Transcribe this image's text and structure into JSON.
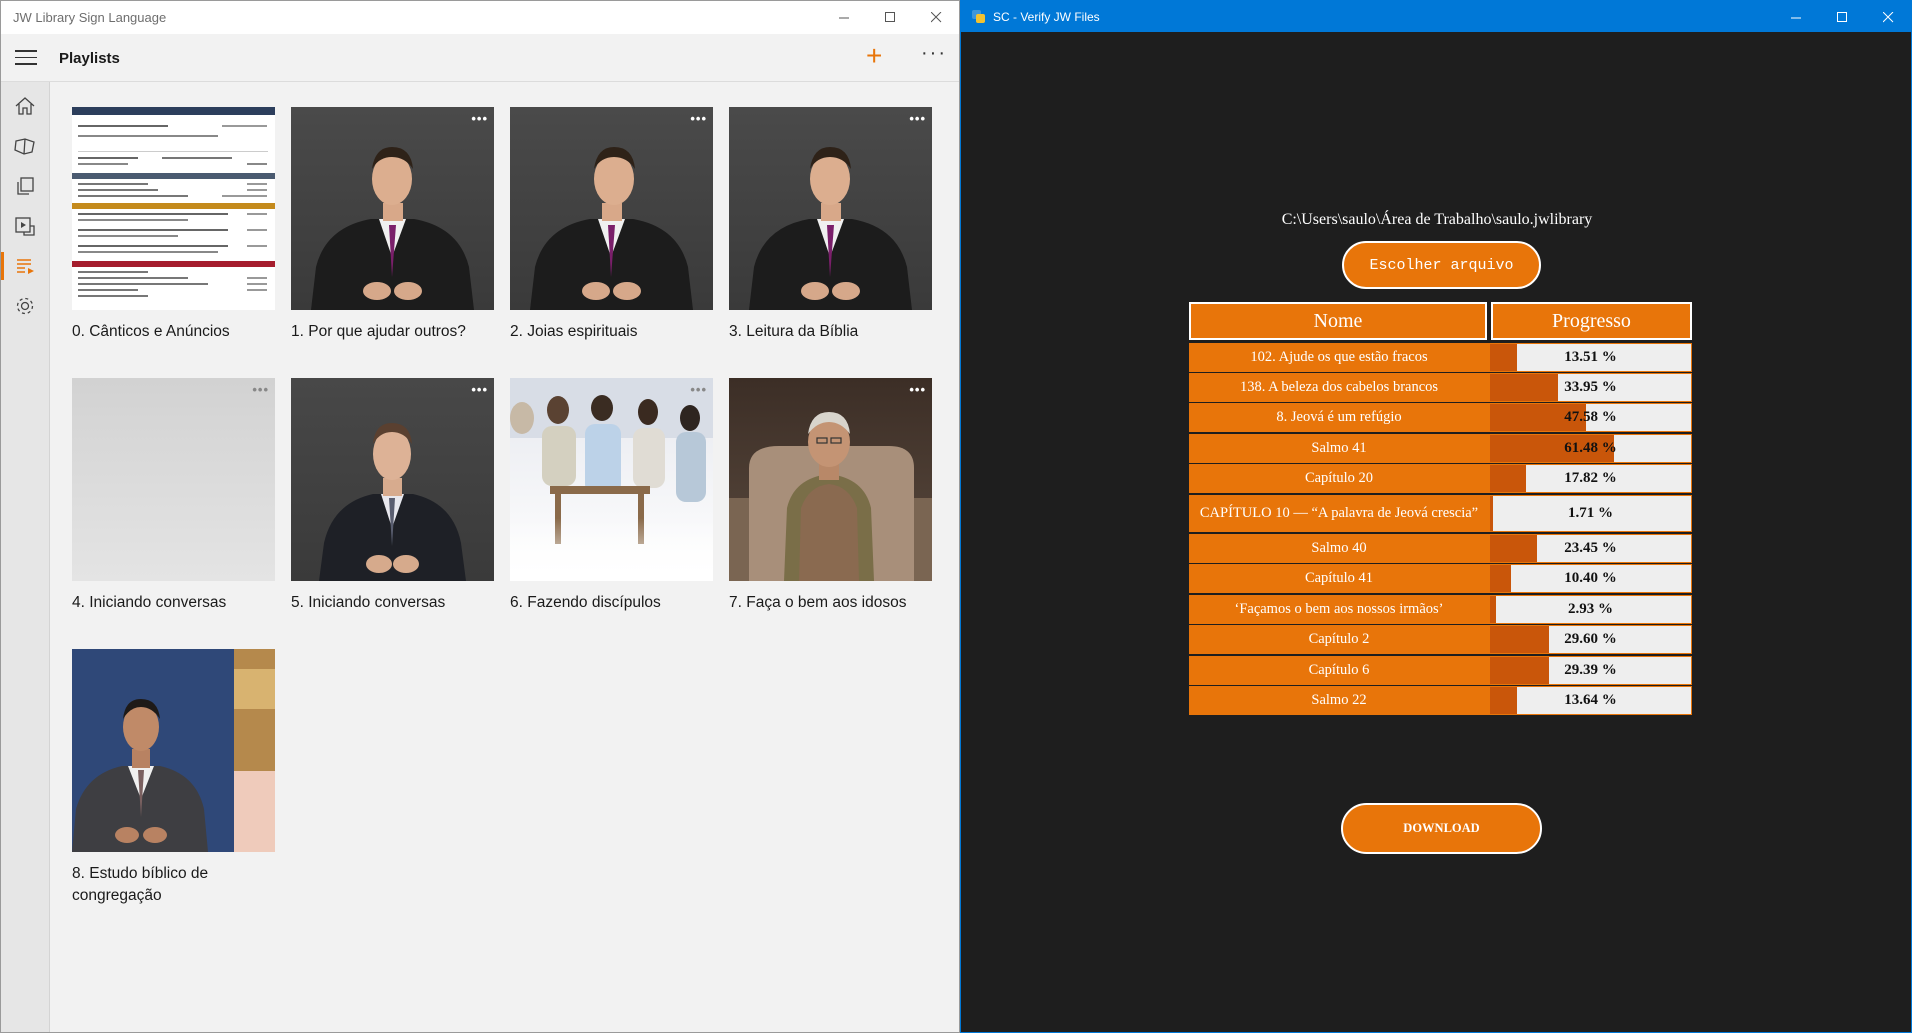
{
  "left_window": {
    "title": "JW Library Sign Language",
    "page_title": "Playlists",
    "add_glyph": "+",
    "more_glyph": "···",
    "sidebar": [
      {
        "icon": "home-icon",
        "active": false
      },
      {
        "icon": "book-icon",
        "active": false
      },
      {
        "icon": "copy-icon",
        "active": false
      },
      {
        "icon": "media-icon",
        "active": false
      },
      {
        "icon": "playlist-icon",
        "active": true
      },
      {
        "icon": "gear-icon",
        "active": false
      }
    ],
    "playlists": [
      {
        "title": "0. Cânticos e Anúncios",
        "thumb": "document"
      },
      {
        "title": "1. Por que ajudar outros?",
        "thumb": "signer-dark"
      },
      {
        "title": "2. Joias espirituais",
        "thumb": "signer-dark"
      },
      {
        "title": "3. Leitura da Bíblia",
        "thumb": "signer-dark"
      },
      {
        "title": "4. Iniciando conversas",
        "thumb": "blank"
      },
      {
        "title": "5. Iniciando conversas",
        "thumb": "signer-gray"
      },
      {
        "title": "6. Fazendo discípulos",
        "thumb": "group"
      },
      {
        "title": "7. Faça o bem aos idosos",
        "thumb": "elder"
      },
      {
        "title": "8. Estudo bíblico de congregação",
        "thumb": "signer-blue"
      }
    ]
  },
  "right_window": {
    "title": "SC - Verify JW Files",
    "file_path": "C:\\Users\\saulo\\Área de Trabalho\\saulo.jwlibrary",
    "choose_button": "Escolher arquivo",
    "table": {
      "headers": [
        "Nome",
        "Progresso"
      ],
      "rows": [
        {
          "name": "102. Ajude os que estão fracos",
          "progress": 13.51,
          "label": "13.51 %"
        },
        {
          "name": "138. A beleza dos cabelos brancos",
          "progress": 33.95,
          "label": "33.95 %"
        },
        {
          "name": "8. Jeová é um refúgio",
          "progress": 47.58,
          "label": "47.58 %"
        },
        {
          "name": "Salmo 41",
          "progress": 61.48,
          "label": "61.48 %"
        },
        {
          "name": "Capítulo 20",
          "progress": 17.82,
          "label": "17.82 %"
        },
        {
          "name": "CAPÍTULO 10 — “A palavra de Jeová crescia”",
          "progress": 1.71,
          "label": "1.71 %"
        },
        {
          "name": "Salmo 40",
          "progress": 23.45,
          "label": "23.45 %"
        },
        {
          "name": "Capítulo 41",
          "progress": 10.4,
          "label": "10.40 %"
        },
        {
          "name": "‘Façamos o bem aos nossos irmãos’",
          "progress": 2.93,
          "label": "2.93 %"
        },
        {
          "name": "Capítulo 2",
          "progress": 29.6,
          "label": "29.60 %"
        },
        {
          "name": "Capítulo 6",
          "progress": 29.39,
          "label": "29.39 %"
        },
        {
          "name": "Salmo 22",
          "progress": 13.64,
          "label": "13.64 %"
        }
      ]
    },
    "download_button": "DOWNLOAD"
  },
  "colors": {
    "accent": "#e8750a",
    "fill_dark": "#c9560a",
    "titlebar_blue": "#0078d7"
  }
}
